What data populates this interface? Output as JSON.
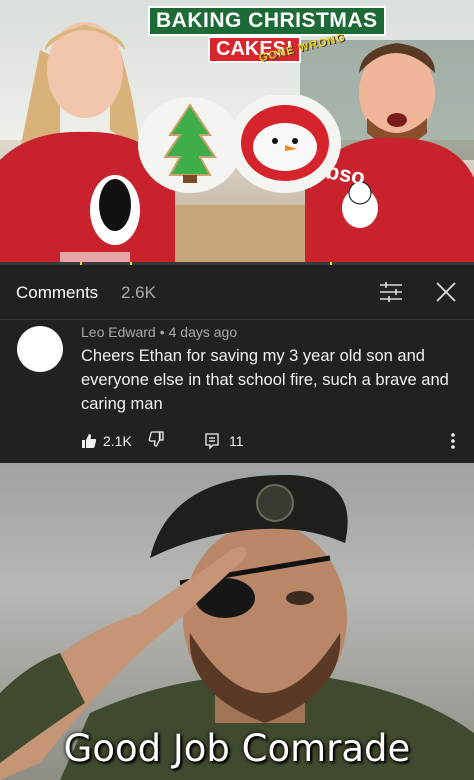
{
  "video": {
    "title_line1": "BAKING CHRISTMAS",
    "title_line2": "CAKES!",
    "subtitle": "GONE WRONG"
  },
  "comments_panel": {
    "title": "Comments",
    "count": "2.6K",
    "filter_icon": "sliders-icon",
    "close_icon": "close-icon"
  },
  "comment": {
    "author": "Leo Edward",
    "time": "4 days ago",
    "text": "Cheers Ethan for saving my 3 year old son and everyone else in that school fire, such a brave and caring man",
    "likes": "2.1K",
    "replies": "11",
    "like_icon": "thumbs-up-icon",
    "dislike_icon": "thumbs-down-icon",
    "reply_icon": "reply-icon",
    "more_icon": "more-vertical-icon"
  },
  "meme": {
    "caption": "Good Job Comrade"
  },
  "colors": {
    "panel_bg": "#212121",
    "text_primary": "#f1f1f1",
    "text_secondary": "#aaaaaa"
  }
}
